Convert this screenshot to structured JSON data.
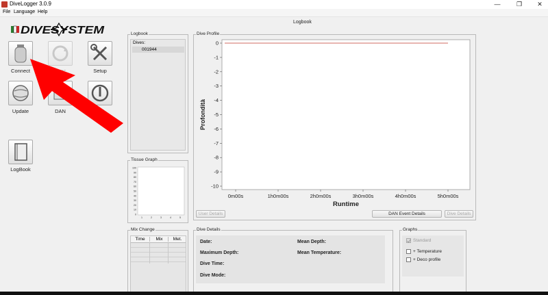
{
  "window": {
    "title": "DiveLogger 3.0.9",
    "controls": {
      "minimize": "—",
      "restore": "❐",
      "close": "✕"
    }
  },
  "menu": [
    "File",
    "Language",
    "Help"
  ],
  "brand": {
    "logo_text": "DIVESYSTEM"
  },
  "header": {
    "section_title": "Logbook"
  },
  "toolbar": {
    "connect": "Connect",
    "sync": "Sync",
    "setup": "Setup",
    "update": "Update",
    "dan": "DAN",
    "exit": "Exit",
    "logbook": "LogBook"
  },
  "logbook_panel": {
    "title": "Logbook",
    "header": "Dives:",
    "dives": [
      "001944"
    ]
  },
  "tissue_panel": {
    "title": "Tissue Graph"
  },
  "mix_panel": {
    "title": "Mix Change",
    "columns": [
      "Time",
      "Mix",
      "Met."
    ]
  },
  "dive_profile": {
    "title": "Dive Profile",
    "buttons": {
      "user_details": "User Details",
      "dan_event_details": "DAN Event Details",
      "dive_details": "Dive Details"
    }
  },
  "dive_details": {
    "title": "Dive Details",
    "date": "Date:",
    "max_depth": "Maximum Depth:",
    "dive_time": "Dive Time:",
    "dive_mode": "Dive Mode:",
    "mean_depth": "Mean Depth:",
    "mean_temp": "Mean Temperature:"
  },
  "graphs_panel": {
    "title": "Graphs",
    "options": [
      {
        "label": "Standard",
        "checked": true,
        "enabled": false
      },
      {
        "label": "+ Temperature",
        "checked": false,
        "enabled": true
      },
      {
        "label": "+ Deco profile",
        "checked": false,
        "enabled": true
      }
    ]
  },
  "chart_data": [
    {
      "type": "line",
      "x": [
        "0m00s",
        "1h0m00s",
        "2h0m00s",
        "3h0m00s",
        "4h0m00s",
        "5h0m00s"
      ],
      "y_ticks": [
        0,
        -1,
        -2,
        -3,
        -4,
        -5,
        -6,
        -7,
        -8,
        -9,
        -10
      ],
      "ylim": [
        -10,
        0
      ],
      "xlabel": "Runtime",
      "ylabel": "Profondità",
      "series": [
        {
          "values": [
            0,
            0,
            0,
            0,
            0,
            0
          ]
        }
      ],
      "line_color": "#c0392b",
      "grid": false
    },
    {
      "type": "line",
      "x_ticks": [
        1,
        2,
        3,
        4,
        5
      ],
      "y_ticks": [
        100,
        90,
        80,
        70,
        60,
        50,
        40,
        30,
        20,
        10,
        0
      ],
      "ylim": [
        0,
        100
      ],
      "grid": false
    }
  ],
  "accent_color": "#ff0000"
}
